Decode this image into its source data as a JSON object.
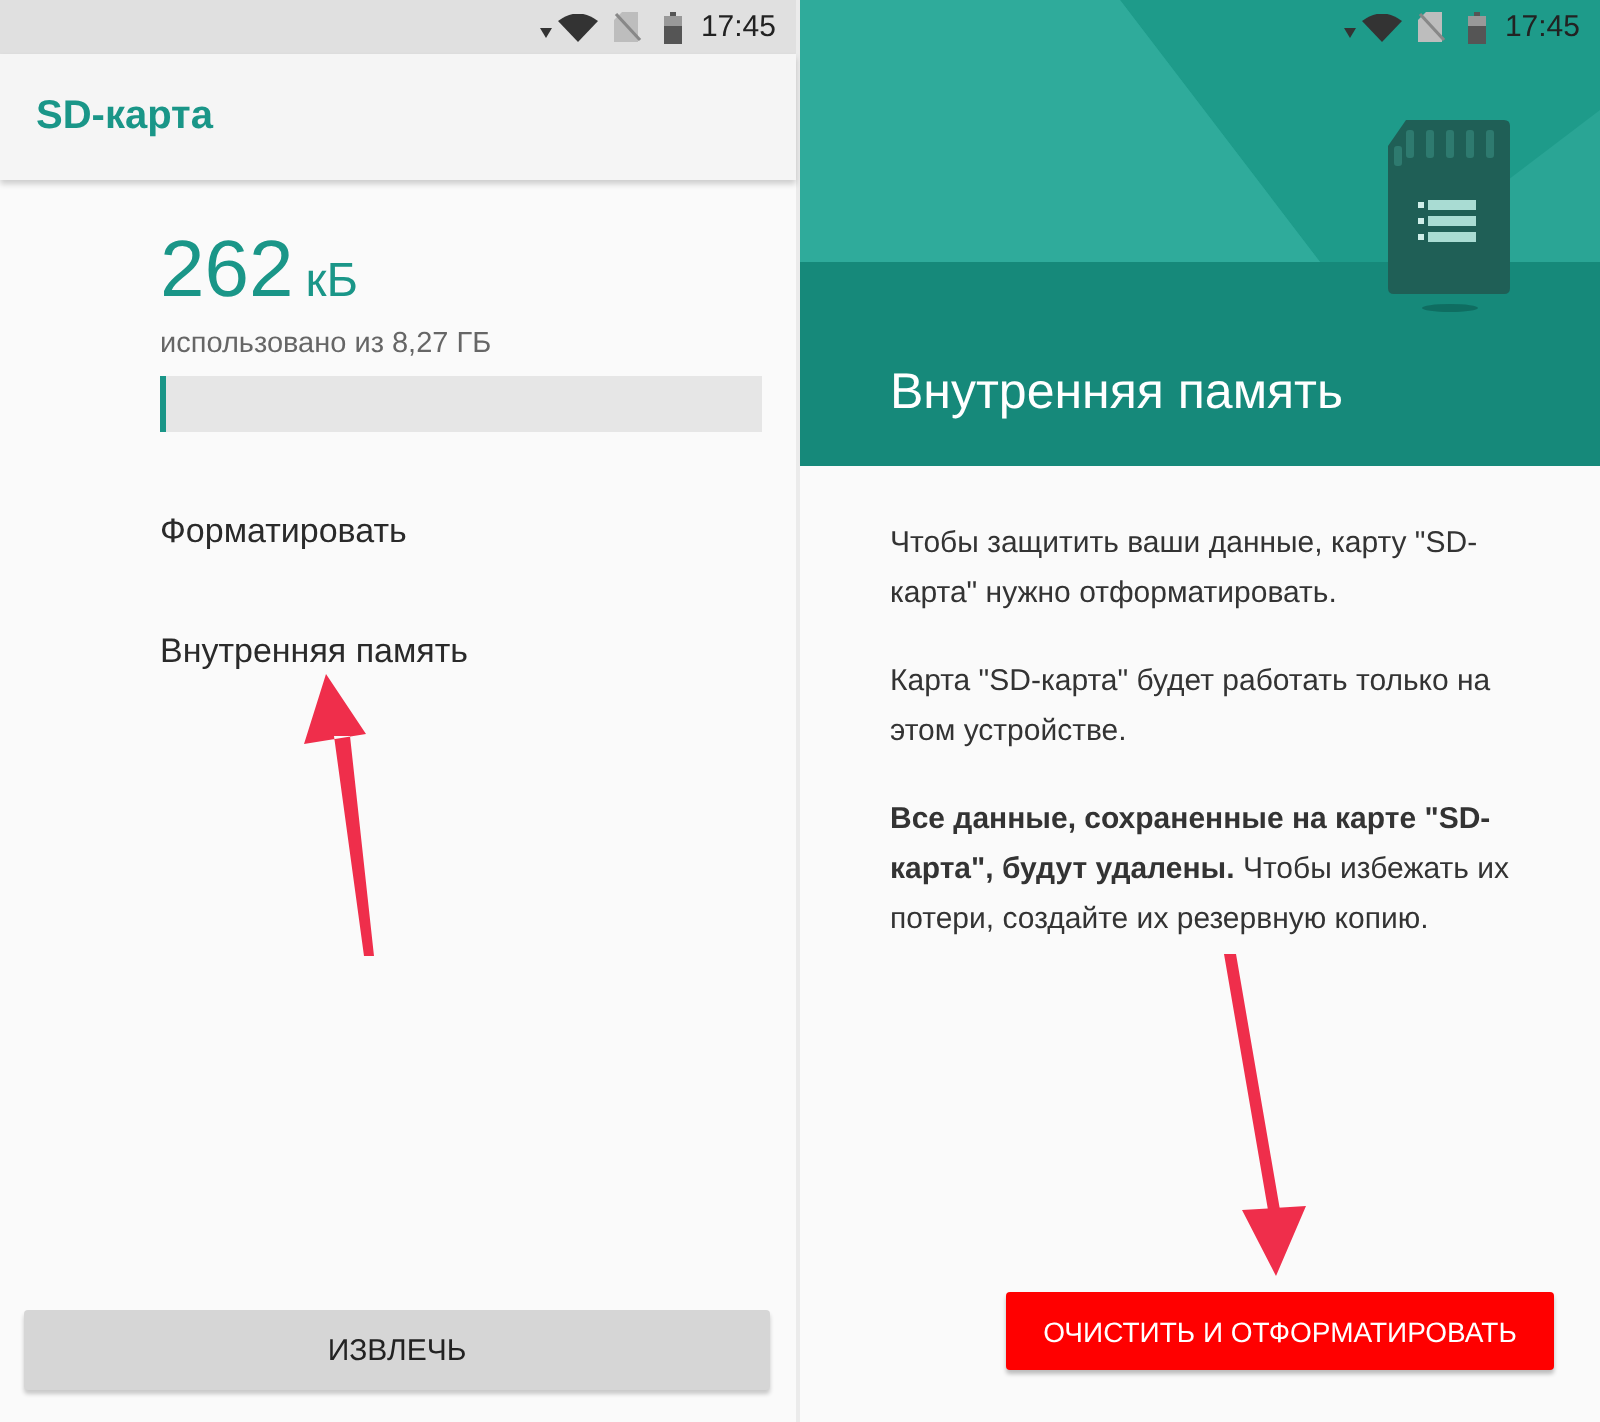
{
  "left_screen": {
    "status_bar": {
      "time": "17:45"
    },
    "app_bar": {
      "title": "SD-карта"
    },
    "usage": {
      "amount": "262",
      "unit": "кБ",
      "caption": "использовано из 8,27 ГБ",
      "level": 0.01
    },
    "menu_items": [
      {
        "label": "Форматировать"
      },
      {
        "label": "Внутренняя память"
      }
    ],
    "eject_button": {
      "label": "ИЗВЛЕЧЬ"
    }
  },
  "right_screen": {
    "status_bar": {
      "time": "17:45"
    },
    "header": {
      "title": "Внутренняя память"
    },
    "paragraphs": [
      "Чтобы защитить ваши данные, карту \"SD-карта\" нужно отформатировать.",
      "Карта \"SD-карта\" будет работать только на этом устройстве.",
      "**Все данные, сохраненные на карте \"SD-карта\", будут удалены.** Чтобы избежать их потери, создайте их резервную копию."
    ],
    "format_button": {
      "label": "ОЧИСТИТЬ И ОТФОРМАТИРОВАТЬ"
    }
  }
}
